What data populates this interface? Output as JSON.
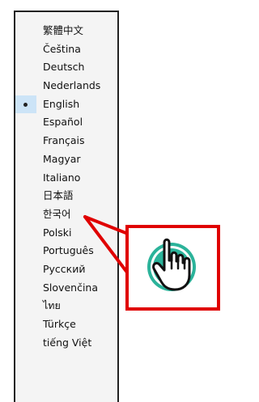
{
  "language_menu": {
    "selected_language": "English",
    "items": [
      {
        "label": "繁體中文",
        "selected": false
      },
      {
        "label": "Čeština",
        "selected": false
      },
      {
        "label": "Deutsch",
        "selected": false
      },
      {
        "label": "Nederlands",
        "selected": false
      },
      {
        "label": "English",
        "selected": true
      },
      {
        "label": "Español",
        "selected": false
      },
      {
        "label": "Français",
        "selected": false
      },
      {
        "label": "Magyar",
        "selected": false
      },
      {
        "label": "Italiano",
        "selected": false
      },
      {
        "label": "日本語",
        "selected": false
      },
      {
        "label": "한국어",
        "selected": false
      },
      {
        "label": "Polski",
        "selected": false
      },
      {
        "label": "Português",
        "selected": false
      },
      {
        "label": "Русский",
        "selected": false
      },
      {
        "label": "Slovenčina",
        "selected": false
      },
      {
        "label": "ไทย",
        "selected": false
      },
      {
        "label": "Türkçe",
        "selected": false
      },
      {
        "label": "tiếng Việt",
        "selected": false
      }
    ]
  },
  "callout": {
    "target_item": "日本語",
    "icon": "tap-hand-icon",
    "colors": {
      "frame": "#e00000",
      "ring": "#2bb39a",
      "selection": "#cce4f7"
    }
  }
}
